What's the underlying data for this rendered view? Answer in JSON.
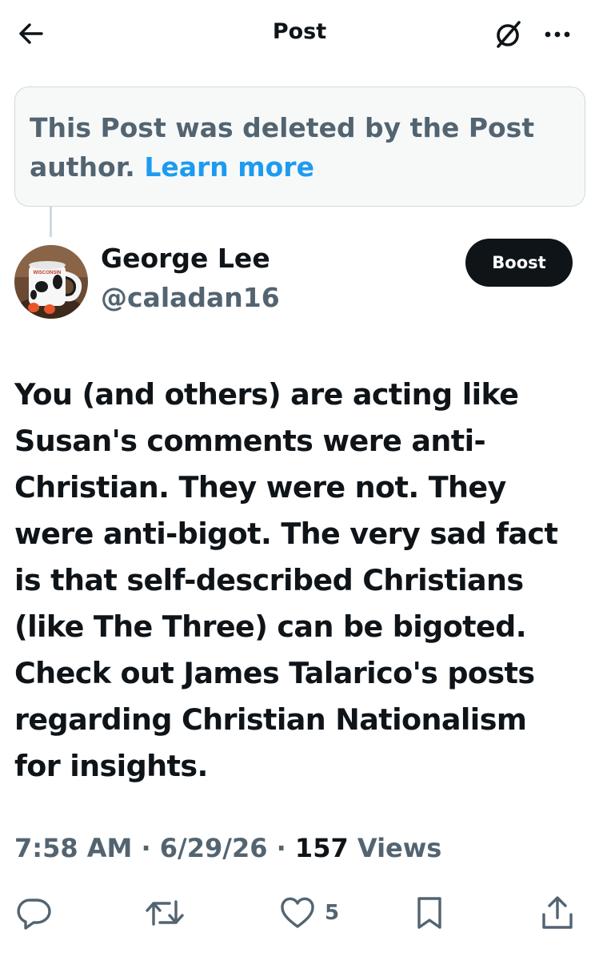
{
  "header": {
    "title": "Post",
    "back_icon": "arrow-left-icon",
    "grok_icon": "grok-icon",
    "more_icon": "more-horizontal-icon"
  },
  "deleted_notice": {
    "text": "This Post was deleted by the Post author.",
    "link": "Learn more"
  },
  "author": {
    "display_name": "George Lee",
    "handle": "@caladan16",
    "avatar_icon": "cow-mug-avatar",
    "avatar_mug_text": "WISCONSIN"
  },
  "boost_label": "Boost",
  "post": {
    "text": "You (and others) are acting like\nSusan's comments were anti-\nChristian. They were not.  They\nwere anti-bigot. The very sad fact\nis that self-described Christians\n(like The Three) can be bigoted.\nCheck out James Talarico's posts\nregarding Christian Nationalism\nfor insights."
  },
  "meta": {
    "time": "7:58 AM",
    "date": "6/29/26",
    "views_count": "157",
    "views_label": "Views",
    "separator": "·"
  },
  "actions": {
    "reply_icon": "reply-icon",
    "repost_icon": "repost-icon",
    "like_icon": "heart-icon",
    "like_count": "5",
    "bookmark_icon": "bookmark-icon",
    "share_icon": "share-icon"
  },
  "colors": {
    "text": "#0f1419",
    "secondary": "#536471",
    "link": "#1d9bf0",
    "border": "#cfd9de"
  }
}
